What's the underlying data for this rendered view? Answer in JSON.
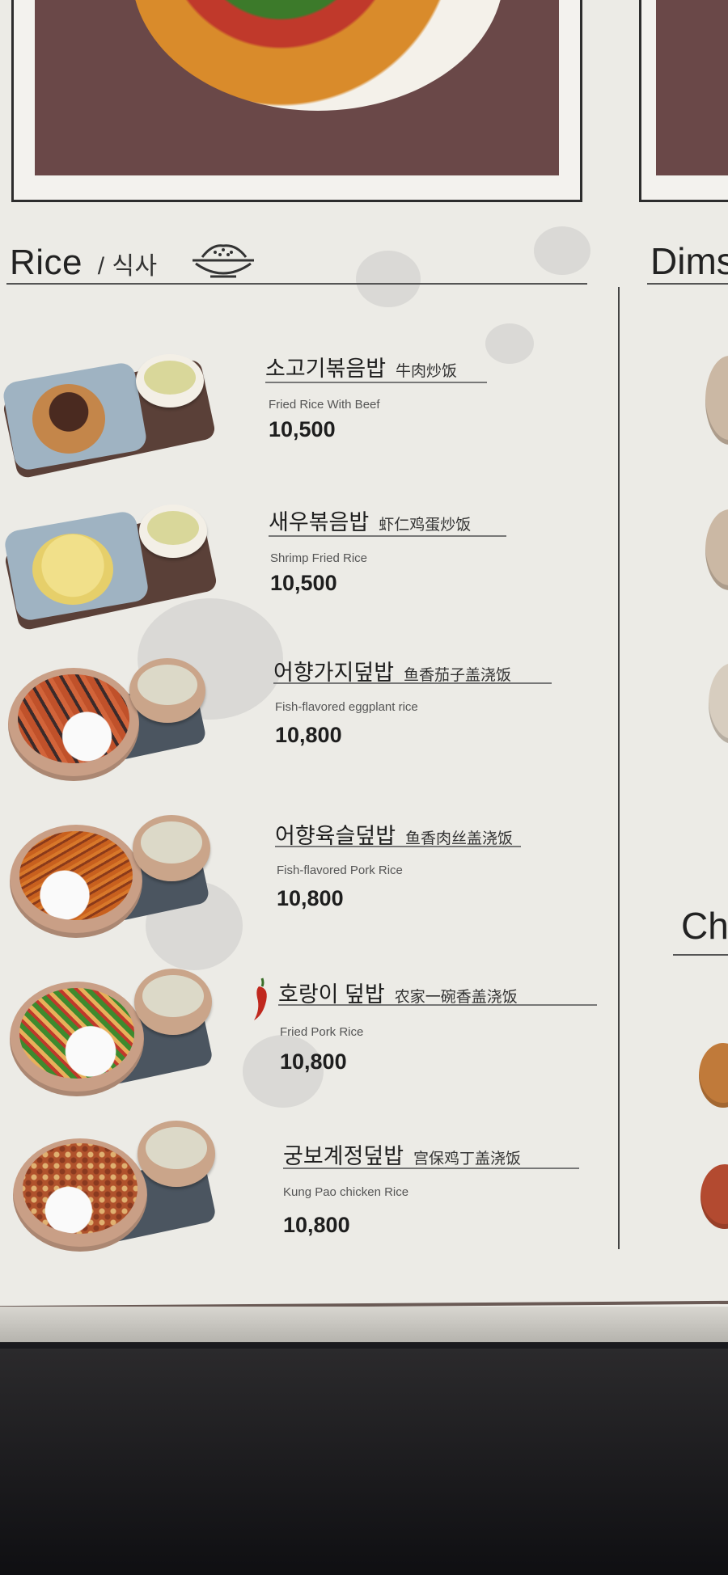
{
  "section": {
    "title": "Rice",
    "subtitle": "/ 식사",
    "icon": "rice-bowl-icon"
  },
  "right_column": {
    "header_fragment": "Dims",
    "header_fragment_2": "Ch"
  },
  "items": [
    {
      "name_ko": "소고기볶음밥",
      "name_zh": "牛肉炒饭",
      "name_en": "Fried Rice With Beef",
      "price": "10,500",
      "spicy": false
    },
    {
      "name_ko": "새우볶음밥",
      "name_zh": "虾仁鸡蛋炒饭",
      "name_en": "Shrimp Fried Rice",
      "price": "10,500",
      "spicy": false
    },
    {
      "name_ko": "어향가지덮밥",
      "name_zh": "鱼香茄子盖浇饭",
      "name_en": "Fish-flavored eggplant rice",
      "price": "10,800",
      "spicy": false
    },
    {
      "name_ko": "어향육슬덮밥",
      "name_zh": "鱼香肉丝盖浇饭",
      "name_en": "Fish-flavored Pork Rice",
      "price": "10,800",
      "spicy": false
    },
    {
      "name_ko": "호랑이 덮밥",
      "name_zh": "农家一碗香盖浇饭",
      "name_en": "Fried Pork Rice",
      "price": "10,800",
      "spicy": true
    },
    {
      "name_ko": "궁보계정덮밥",
      "name_zh": "宫保鸡丁盖浇饭",
      "name_en": "Kung Pao chicken Rice",
      "price": "10,800",
      "spicy": false
    }
  ],
  "colors": {
    "paper": "#ecebe6",
    "frame_photo_bg": "#6a4848",
    "text": "#1e1e1e",
    "chili": "#c0281e"
  }
}
